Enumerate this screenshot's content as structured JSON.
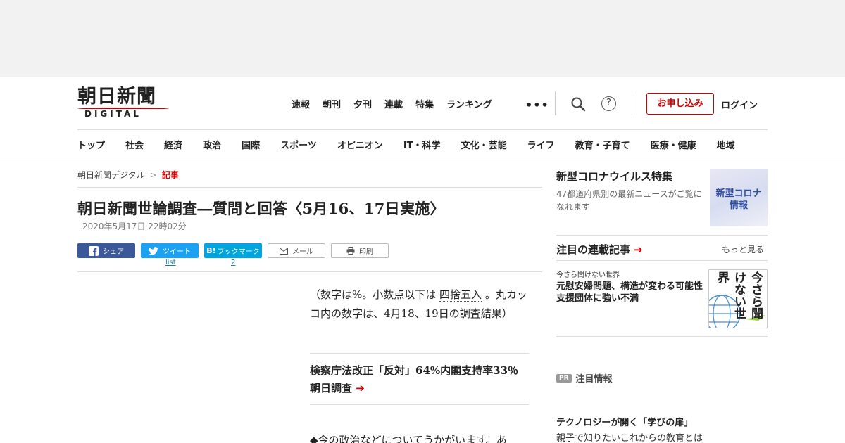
{
  "logo": {
    "kanji": "朝日新聞",
    "sub": "DIGITAL"
  },
  "top_nav": [
    "速報",
    "朝刊",
    "夕刊",
    "連載",
    "特集",
    "ランキング"
  ],
  "header": {
    "more": "•••",
    "help": "?",
    "apply": "お申し込み",
    "login": "ログイン"
  },
  "categories": [
    "トップ",
    "社会",
    "経済",
    "政治",
    "国際",
    "スポーツ",
    "オピニオン",
    "IT・科学",
    "文化・芸能",
    "ライフ",
    "教育・子育て",
    "医療・健康",
    "地域"
  ],
  "breadcrumb": {
    "home": "朝日新聞デジタル",
    "sep": ">",
    "current": "記事"
  },
  "article": {
    "title": "朝日新聞世論調査―質問と回答〈5月16、17日実施〉",
    "date": "2020年5月17日 22時02分",
    "intro_before": "（数字は%。小数点以下は ",
    "intro_term": "四捨五入",
    "intro_after": " 。丸カッコ内の数字は、4月18、19日の調査結果）",
    "related_text": "検察庁法改正「反対」64%内閣支持率33％　朝日調査",
    "related_arrow": "➔",
    "body_start": "◆今の政治などについてうかがいます。あ"
  },
  "share": {
    "facebook": "シェア",
    "twitter": "ツイート",
    "twitter_count": "list",
    "hatena_icon": "B!",
    "hatena": "ブックマーク",
    "hatena_count": "2",
    "mail": "メール",
    "print": "印刷"
  },
  "sidebar": {
    "feature_title": "新型コロナウイルス特集",
    "feature_desc": "47都道府県別の最新ニュースがご覧になれます",
    "feature_thumb_line1": "新型コロナ",
    "feature_thumb_line2": "情報",
    "series_heading": "注目の連載記事",
    "series_arrow": "➔",
    "more": "もっと見る",
    "series_label": "今さら聞けない世界",
    "series_title": "元慰安婦問題、構造が変わる可能性　支援団体に強い不満",
    "series_thumb_text": "今さら聞けない世界",
    "pr_badge": "PR",
    "pr_label": "注目情報",
    "tech_title": "テクノロジーが開く「学びの扉」",
    "tech_sub": "親子で知りたいこれからの教育とは"
  },
  "colors": {
    "accent": "#cc0000",
    "facebook": "#3b5998",
    "twitter": "#1da1f2",
    "hatena": "#00a4de",
    "link": "#1a7bb0"
  }
}
